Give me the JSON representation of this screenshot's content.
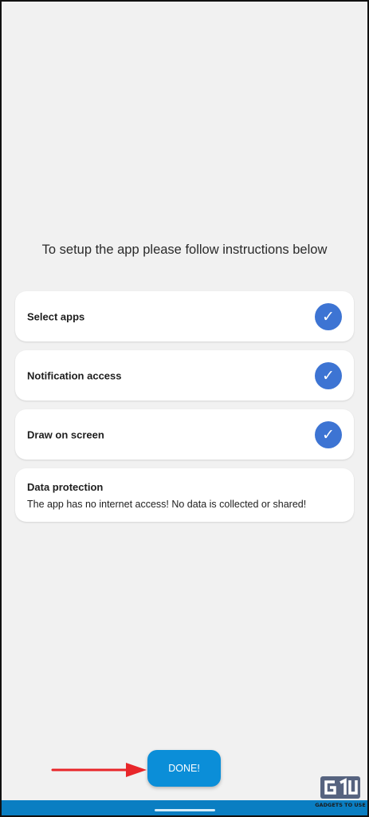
{
  "instructions": "To setup the app please follow instructions below",
  "steps": [
    {
      "label": "Select apps",
      "completed": true,
      "check_icon": "checkmark-icon"
    },
    {
      "label": "Notification access",
      "completed": true,
      "check_icon": "checkmark-icon"
    },
    {
      "label": "Draw on screen",
      "completed": true,
      "check_icon": "checkmark-icon"
    }
  ],
  "data_protection": {
    "title": "Data protection",
    "description": "The app has no internet access! No data is collected or shared!"
  },
  "done_button": {
    "label": "DONE!"
  },
  "annotation": {
    "icon": "red-arrow-icon",
    "color": "#e8262a"
  },
  "watermark": {
    "text": "GADGETS TO USE",
    "icon": "gadgets-to-use-logo"
  },
  "colors": {
    "background": "#f1f1f1",
    "check": "#3d74d3",
    "done_button": "#0b8ed8",
    "nav_bar": "#0a7ec2"
  }
}
